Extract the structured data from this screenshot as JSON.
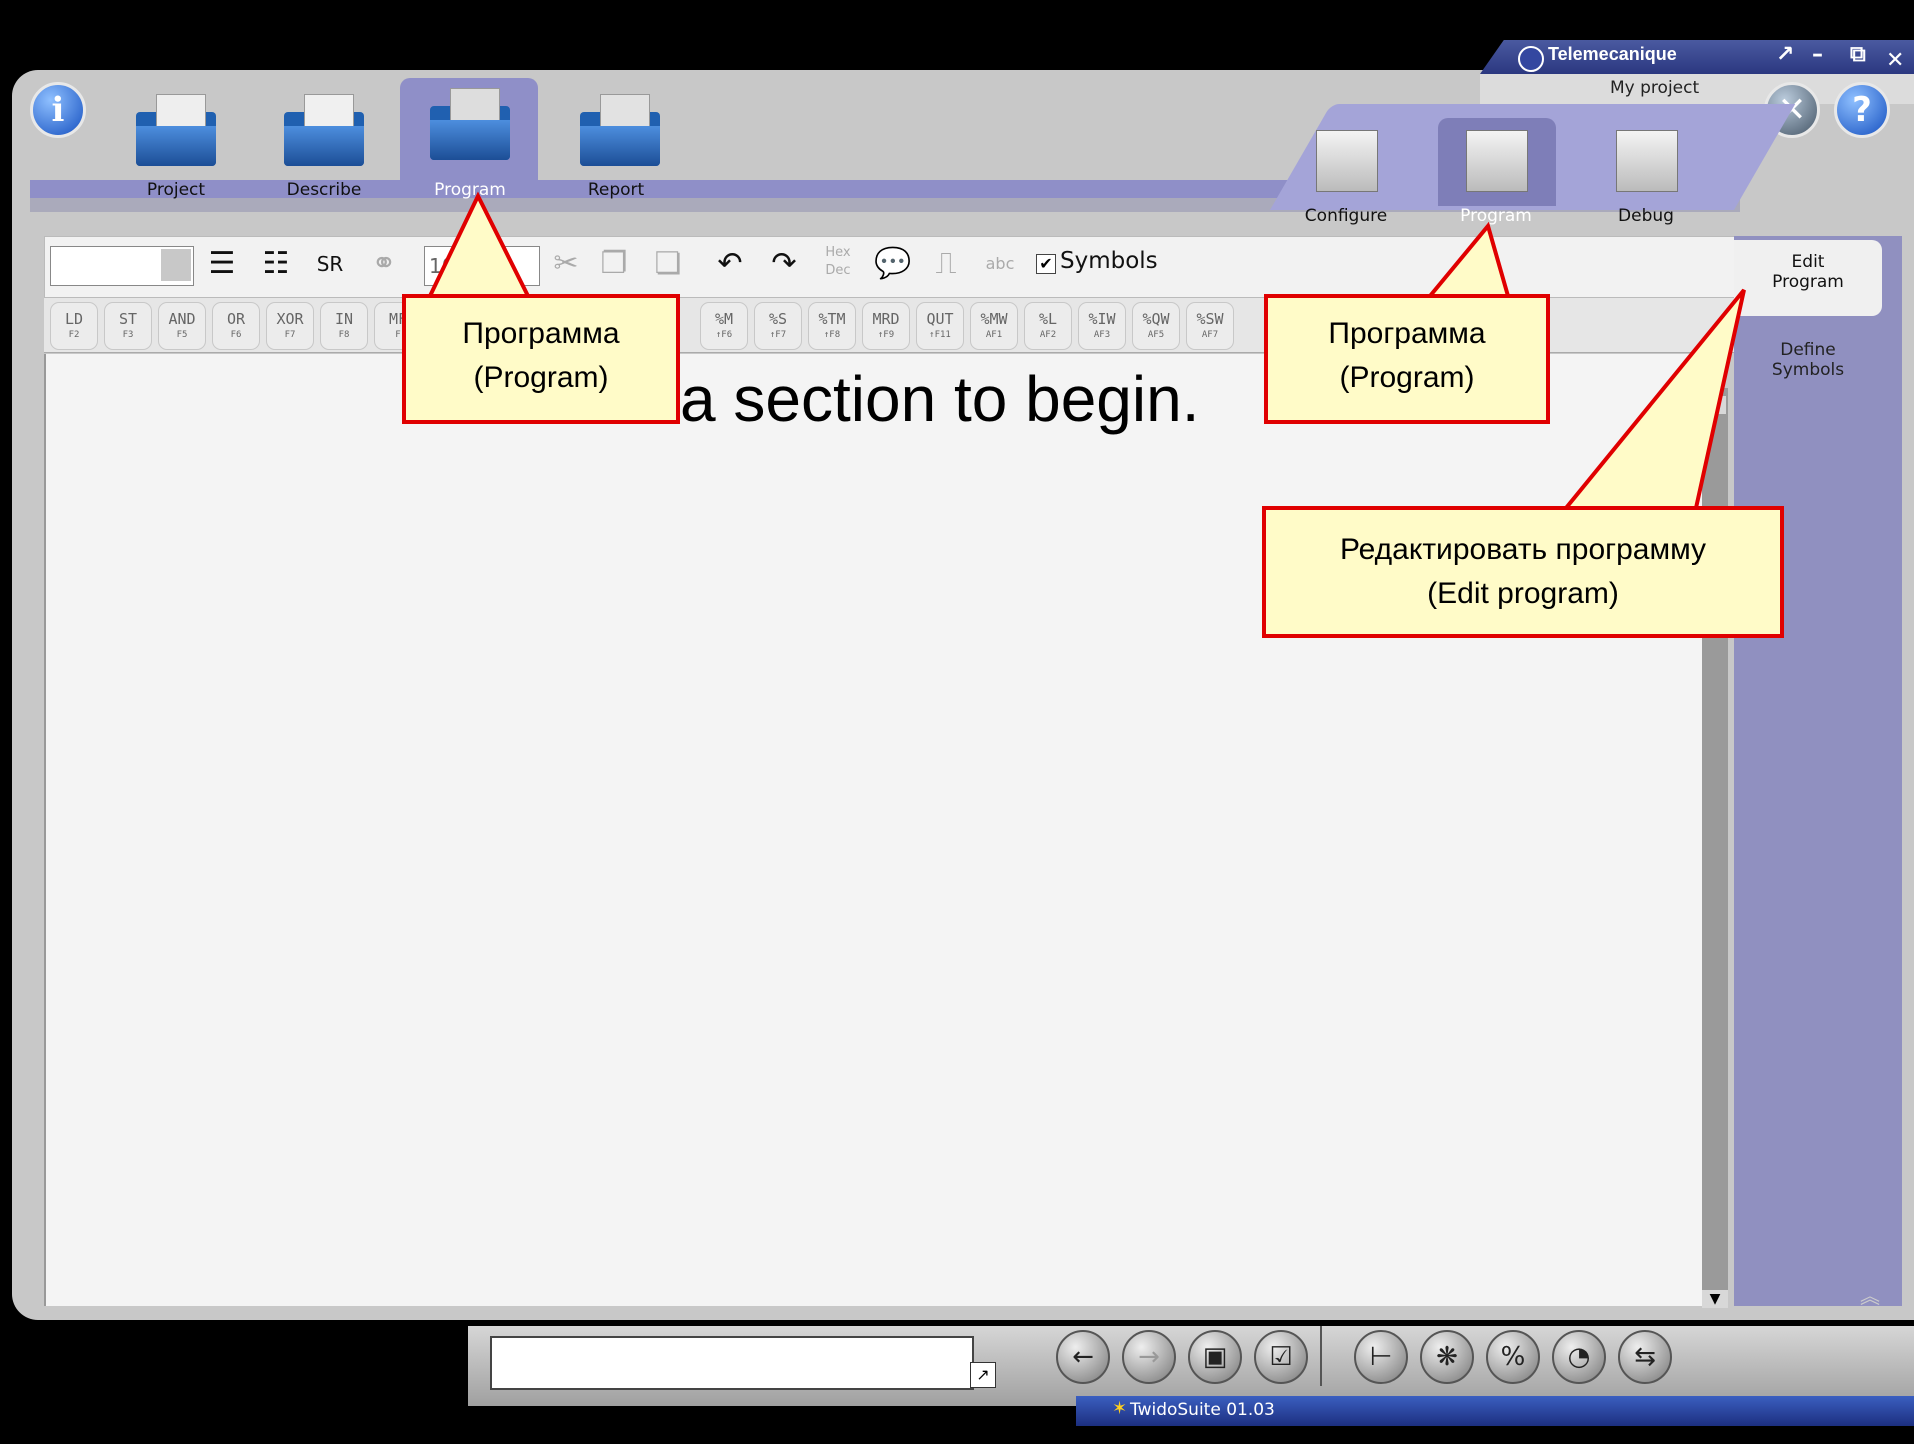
{
  "window": {
    "brand": "Telemecanique",
    "project_name": "My project",
    "win_btn_restore": "↗",
    "win_btn_minimize": "–",
    "win_btn_maximize": "⧉",
    "win_btn_close": "✕"
  },
  "top_tabs": [
    {
      "label": "Project"
    },
    {
      "label": "Describe"
    },
    {
      "label": "Program"
    },
    {
      "label": "Report"
    }
  ],
  "sub_tabs": [
    {
      "label": "Configure"
    },
    {
      "label": "Program"
    },
    {
      "label": "Debug"
    }
  ],
  "toolbar": {
    "zoom_value": "10",
    "symbols_label": "Symbols",
    "symbols_checked": "✔",
    "hex_label": "Hex",
    "dec_label": "Dec",
    "abc_label": "abc"
  },
  "instruction_buttons": [
    {
      "m": "LD",
      "s": "F2"
    },
    {
      "m": "ST",
      "s": "F3"
    },
    {
      "m": "AND",
      "s": "F5"
    },
    {
      "m": "OR",
      "s": "F6"
    },
    {
      "m": "XOR",
      "s": "F7"
    },
    {
      "m": "IN",
      "s": "F8"
    },
    {
      "m": "MF",
      "s": "F"
    },
    {
      "m": "%M",
      "s": "↑F6"
    },
    {
      "m": "%S",
      "s": "↑F7"
    },
    {
      "m": "%TM",
      "s": "↑F8"
    },
    {
      "m": "MRD",
      "s": "↑F9"
    },
    {
      "m": "QUT",
      "s": "↑F11"
    },
    {
      "m": "%MW",
      "s": "AF1"
    },
    {
      "m": "%L",
      "s": "AF2"
    },
    {
      "m": "%IW",
      "s": "AF3"
    },
    {
      "m": "%QW",
      "s": "AF5"
    },
    {
      "m": "%SW",
      "s": "AF7"
    }
  ],
  "editor": {
    "message": "a section to begin."
  },
  "right_panel": {
    "edit_program_line1": "Edit",
    "edit_program_line2": "Program",
    "define_symbols_line1": "Define",
    "define_symbols_line2": "Symbols"
  },
  "status": {
    "version": "TwidoSuite 01.03"
  },
  "callouts": {
    "program_top_ru": "Программа",
    "program_top_en": "(Program)",
    "program_sub_ru": "Программа",
    "program_sub_en": "(Program)",
    "edit_ru": "Редактировать программу",
    "edit_en": "(Edit program)"
  },
  "colors": {
    "tab_band": "#8f8fc8",
    "right_panel": "#9090c0",
    "callout_border": "#e00000",
    "callout_fill": "#fffbc8",
    "statusbar": "#1c2f80"
  }
}
